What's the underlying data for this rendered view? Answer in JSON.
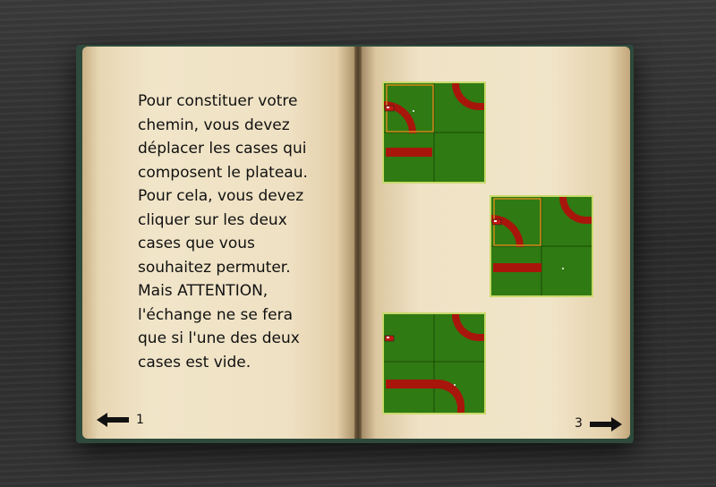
{
  "book": {
    "text_lines": [
      "Pour constituer votre",
      "chemin, vous devez",
      "déplacer les cases qui",
      "composent le plateau.",
      "Pour cela, vous devez",
      "cliquer sur les deux",
      "cases que vous",
      "souhaitez permuter.",
      "Mais ATTENTION,",
      "l'échange ne se fera",
      "que si l'une des deux",
      "cases est vide."
    ],
    "left_page_number": "1",
    "right_page_number": "3"
  },
  "icons": {
    "prev": "arrow-left-icon",
    "next": "arrow-right-icon",
    "train": "train-icon"
  },
  "colors": {
    "tile_green": "#2f7a12",
    "track_red": "#a8150b",
    "selection_orange": "#d08a1a"
  }
}
